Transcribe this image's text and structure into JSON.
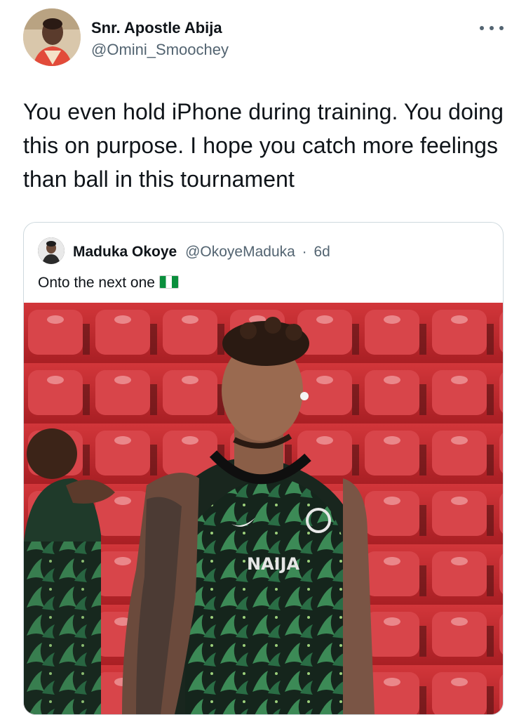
{
  "tweet": {
    "display_name": "Snr. Apostle Abija",
    "handle": "@Omini_Smoochey",
    "text": "You even hold iPhone during training. You doing this on purpose. I hope you catch more feelings than ball in this tournament",
    "menu_icon": "more-horizontal-icon"
  },
  "quoted_tweet": {
    "display_name": "Maduka Okoye",
    "handle": "@OkoyeMaduka",
    "separator": "·",
    "time": "6d",
    "text": "Onto the next one",
    "emoji": "nigeria-flag-icon",
    "jersey_text": "NAIJA"
  },
  "colors": {
    "text_primary": "#0f1419",
    "text_secondary": "#536471",
    "border": "#cfd9de",
    "stadium_red": "#c42b2f",
    "jersey_green": "#1f5b3a"
  }
}
